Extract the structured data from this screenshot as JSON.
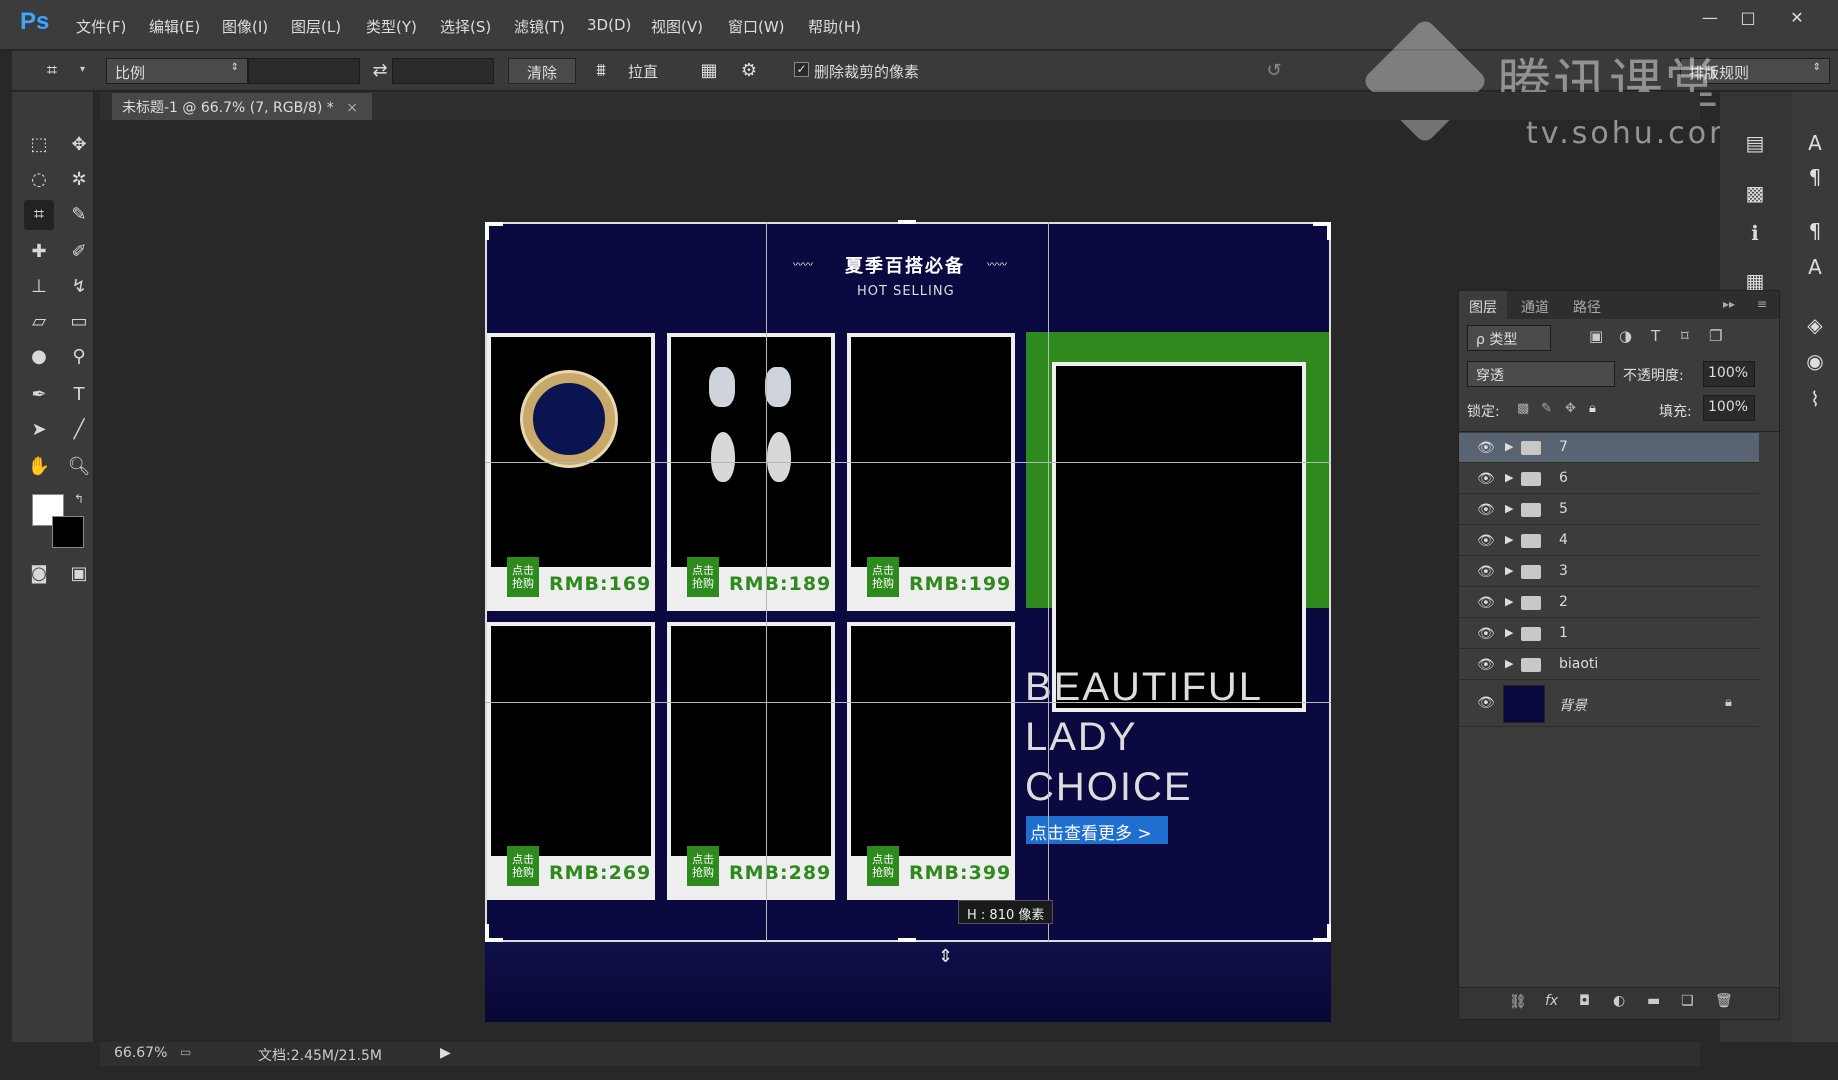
{
  "app": {
    "logo": "Ps"
  },
  "menu": [
    "文件(F)",
    "编辑(E)",
    "图像(I)",
    "图层(L)",
    "类型(Y)",
    "选择(S)",
    "滤镜(T)",
    "3D(D)",
    "视图(V)",
    "窗口(W)",
    "帮助(H)"
  ],
  "window_controls": {
    "minimize": "—",
    "restore": "□",
    "close": "✕"
  },
  "options": {
    "ratio": "比例",
    "clear": "清除",
    "straighten": "拉直",
    "delete_cropped": "删除裁剪的像素",
    "workspace": "排版规则"
  },
  "watermark": {
    "brand": "腾讯课堂",
    "site": "tv.sohu.com"
  },
  "document": {
    "tab": "未标题-1 @ 66.7% (7, RGB/8) *"
  },
  "status": {
    "zoom": "66.67%",
    "doc": "文档:2.45M/21.5M"
  },
  "crop": {
    "dimension": "H : 810 像素"
  },
  "design": {
    "title_cn": "夏季百搭必备",
    "title_en": "HOT SELLING",
    "badge": "点击\n抢购",
    "prices": [
      "RMB:169",
      "RMB:189",
      "RMB:199",
      "RMB:269",
      "RMB:289",
      "RMB:399"
    ],
    "headline": [
      "BEAUTIFUL",
      "LADY",
      "CHOICE"
    ],
    "more": "点击查看更多 >"
  },
  "layers_panel": {
    "tabs": [
      "图层",
      "通道",
      "路径"
    ],
    "filter": "ρ 类型",
    "blend": "穿透",
    "opacity_label": "不透明度:",
    "opacity": "100%",
    "lock_label": "锁定:",
    "fill_label": "填充:",
    "fill": "100%",
    "layers": [
      "7",
      "6",
      "5",
      "4",
      "3",
      "2",
      "1",
      "biaoti"
    ],
    "background": "背景"
  },
  "colors": {
    "accent": "#2e8a1c",
    "canvas_bg": "#0a0a40",
    "link_blue": "#1e6fd0"
  }
}
